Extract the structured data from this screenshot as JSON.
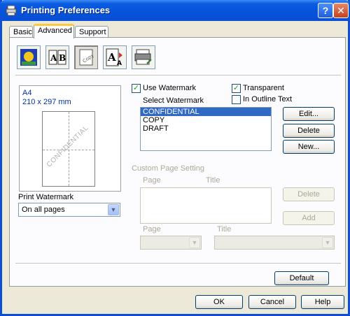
{
  "window": {
    "title": "Printing Preferences",
    "help_glyph": "?",
    "close_glyph": "✕"
  },
  "tabs": [
    "Basic",
    "Advanced",
    "Support"
  ],
  "toolbar_icons": [
    "color-icon",
    "scaling-icon",
    "watermark-icon",
    "device-options-icon",
    "other-settings-icon"
  ],
  "preview": {
    "paper": "A4",
    "size": "210 x 297 mm",
    "watermark_text": "CONFIDENTIAL"
  },
  "print_watermark": {
    "label": "Print Watermark",
    "value": "On all pages"
  },
  "watermark": {
    "use_label": "Use Watermark",
    "use_checked": true,
    "transparent_label": "Transparent",
    "transparent_checked": true,
    "outline_label": "In Outline Text",
    "outline_checked": false,
    "select_label": "Select Watermark",
    "items": [
      "CONFIDENTIAL",
      "COPY",
      "DRAFT"
    ],
    "selected_index": 0,
    "edit_label": "Edit...",
    "delete_label": "Delete",
    "new_label": "New..."
  },
  "custom_page": {
    "group_label": "Custom Page Setting",
    "page_header": "Page",
    "title_header": "Title",
    "delete_label": "Delete",
    "add_label": "Add",
    "page_label": "Page",
    "title_label": "Title"
  },
  "buttons": {
    "default": "Default",
    "ok": "OK",
    "cancel": "Cancel",
    "help": "Help"
  }
}
